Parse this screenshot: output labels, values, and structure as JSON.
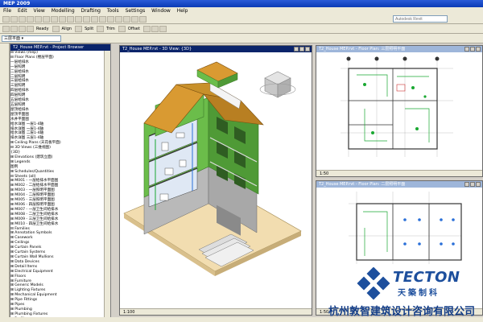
{
  "app": {
    "title": "MEP 2009"
  },
  "menu": [
    "File",
    "Edit",
    "View",
    "Modelling",
    "Drafting",
    "Tools",
    "Settings",
    "Window",
    "Help"
  ],
  "search": {
    "placeholder": "Autodesk Revit"
  },
  "toolbar2": {
    "items": [
      "Ready",
      "Align",
      "Split",
      "Trim",
      "Offset"
    ]
  },
  "type_selector": {
    "value": "三层平面"
  },
  "browser": {
    "title": "T2_House MEP.rvt - Project Browser",
    "tree": [
      "⊟ Views (mep)",
      "   ⊟ Floor Plans (楼层平面)",
      "        一层给排水",
      "        一层照明",
      "        二层给排水",
      "        二层照明",
      "        三层给排水",
      "        三层照明",
      "        四层给排水",
      "        四层照明",
      "        五层给排水",
      "        五层照明",
      "        屋顶给排水",
      "        屋顶平面图",
      "        水井平面图",
      "        给水详图 一层1-4轴",
      "        排水详图 一层1-4轴",
      "        给水详图 二层1-4轴",
      "        排水详图 三层1-4轴",
      "   ⊞ Ceiling Plans (天花板平面)",
      "   ⊟ 3D Views (三维视图)",
      "        {3D}",
      "   ⊞ Elevations (建筑立面)",
      "⊞ Legends",
      "   图例",
      "⊞ Schedules/Quantities",
      "⊟ Sheets (all)",
      "   ⊞ M001 - 一层给排水平面图",
      "   ⊞ M002 - 二层给排水平面图",
      "   ⊞ M003 - 一层照明平面图",
      "   ⊞ M004 - 二层照明平面图",
      "   ⊞ M005 - 三层照明平面图",
      "   ⊞ M006 - 四层照明平面图",
      "   ⊞ M007 - 一层卫生间给排水",
      "   ⊞ M008 - 二层卫生间给排水",
      "   ⊞ M009 - 三层卫生间给排水",
      "   ⊞ M010 - 四层卫生间给排水",
      "⊟ Families",
      "   ⊞ Annotation Symbols",
      "   ⊞ Casework",
      "   ⊞ Ceilings",
      "   ⊞ Curtain Panels",
      "   ⊞ Curtain Systems",
      "   ⊞ Curtain Wall Mullions",
      "   ⊞ Data Devices",
      "   ⊞ Detail Items",
      "   ⊞ Electrical Equipment",
      "   ⊞ Floors",
      "   ⊞ Furniture",
      "   ⊞ Generic Models",
      "   ⊞ Lighting Fixtures",
      "   ⊞ Mechanical Equipment",
      "   ⊞ Pipe Fittings",
      "   ⊞ Pipes",
      "   ⊞ Plumbing",
      "   ⊞ Plumbing Fixtures",
      "   ⊞ Profiles",
      "   ⊞ Railings",
      "   ⊞ Ramps",
      "   ⊞ Roofs"
    ]
  },
  "views": {
    "view3d": {
      "title": "T2_House MEP.rvt - 3D View: {3D}",
      "scale": "1:100"
    },
    "plan_upper": {
      "title": "T2_House MEP.rvt - Floor Plan: 三层照明平面",
      "scale": "1:50"
    },
    "plan_lower": {
      "title": "T2_House MEP.rvt - Floor Plan: 二层照明平面",
      "scale": "1:50"
    }
  },
  "logo": {
    "brand": "TECTON",
    "brand_cn": "天築制科"
  },
  "company": {
    "name": "杭州敦智建筑设计咨询有限公司"
  },
  "colors": {
    "wall_green": "#6bbd4a",
    "roof_orange": "#c8902a",
    "logo_blue": "#1d4f9d",
    "active_title": "#0a246a",
    "pipe_green": "#1aa832"
  }
}
